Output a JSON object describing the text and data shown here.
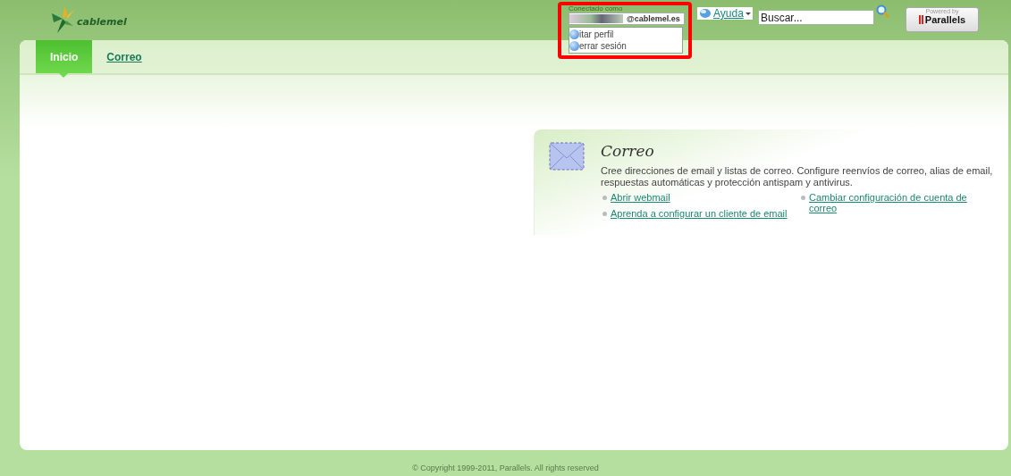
{
  "header": {
    "logo_text": "cablemel",
    "user_label": "Conectado como",
    "user_name": "@cablemel.es",
    "user_menu": [
      {
        "label": "itar perfil"
      },
      {
        "label": "errar sesión"
      }
    ],
    "help": "Ayuda",
    "search": {
      "placeholder": "Buscar..."
    },
    "powered_by": "Powered by",
    "brand": "Parallels"
  },
  "tabs": [
    {
      "label": "Inicio",
      "selected": true
    },
    {
      "label": "Correo",
      "selected": false
    }
  ],
  "card": {
    "title": "Correo",
    "description": "Cree direcciones de email y listas de correo. Configure reenvíos de correo, alias de email, respuestas automáticas y protección antispam y antivirus.",
    "links": [
      {
        "label": "Abrir webmail"
      },
      {
        "label": "Cambiar configuración de cuenta de correo"
      },
      {
        "label": "Aprenda a configurar un cliente de email"
      }
    ]
  },
  "footer": "© Copyright 1999-2011, Parallels. All rights reserved"
}
